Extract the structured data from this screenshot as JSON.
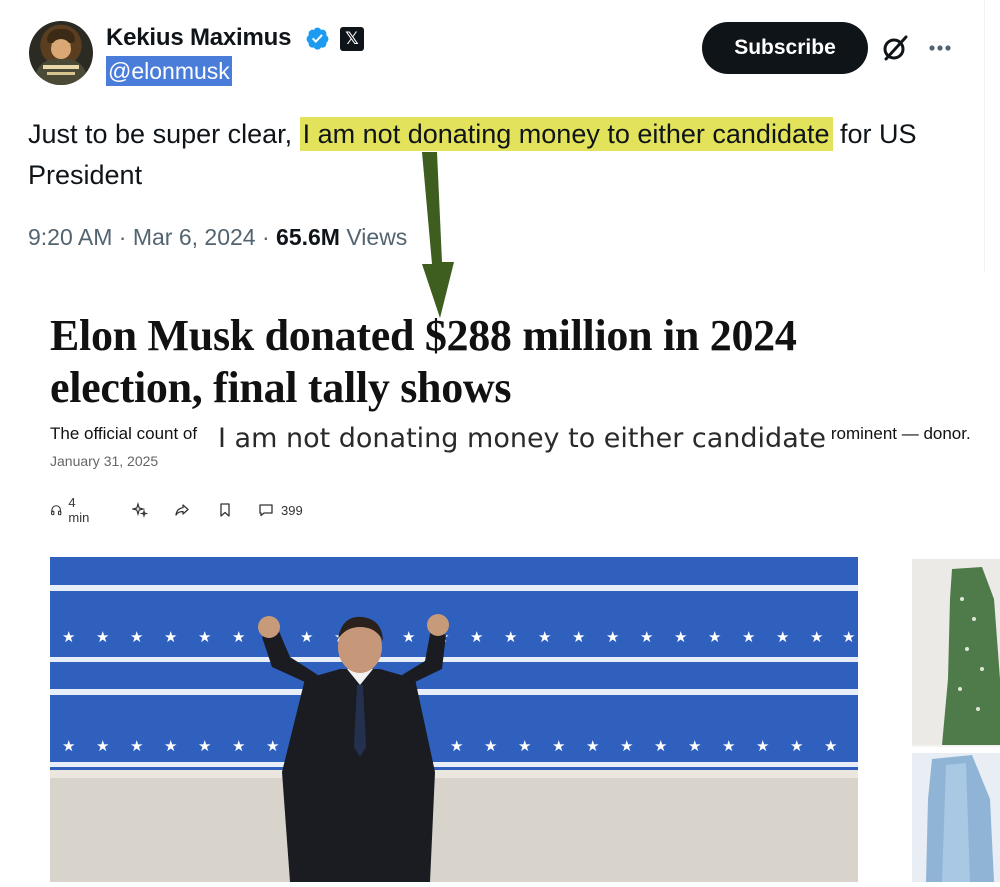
{
  "tweet": {
    "display_name": "Kekius Maximus",
    "handle": "@elonmusk",
    "subscribe_label": "Subscribe",
    "text_before": "Just to be super clear, ",
    "text_highlight": "I am not donating money to either candidate",
    "text_after": " for US President",
    "time": "9:20 AM",
    "date": "Mar 6, 2024",
    "views_count": "65.6M",
    "views_label": "Views",
    "separator": "·",
    "highlight_color": "#e2e35a",
    "handle_highlight_color": "#4a7cd9",
    "verified_color": "#1d9bf0"
  },
  "article": {
    "title": "Elon Musk donated $288 million in 2024 election, final tally shows",
    "subtitle_start": "The official count of ",
    "subtitle_end": "most prominent — donor.",
    "overlay_quote": "I am not donating money to either candidate",
    "date": "January 31, 2025",
    "toolbar": {
      "listen_label": "4 min",
      "comments_count": "399"
    }
  },
  "icons": [
    "verified-icon",
    "x-logo-icon",
    "grok-icon",
    "more-icon",
    "headphones-icon",
    "sparkle-icon",
    "share-icon",
    "bookmark-icon",
    "comment-icon"
  ],
  "annotation_arrow_color": "#3d5e1f"
}
